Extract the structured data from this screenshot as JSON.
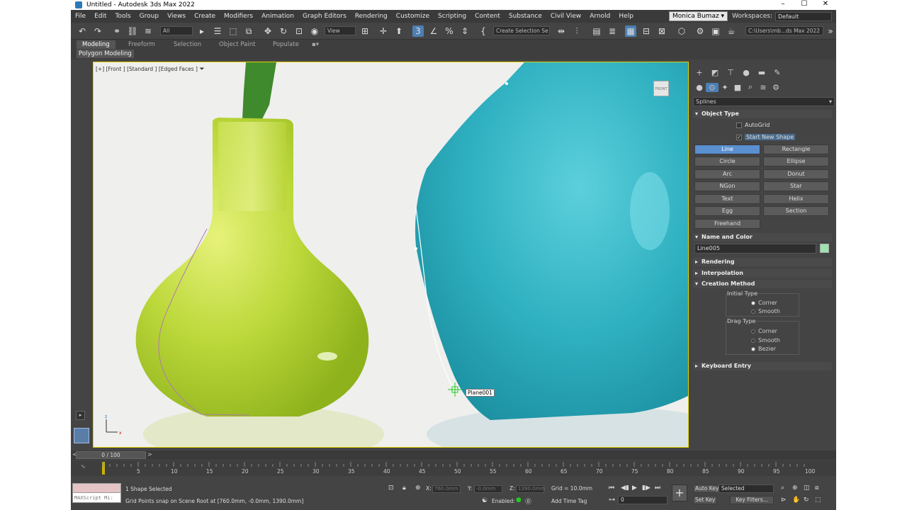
{
  "window": {
    "title": "Untitled - Autodesk 3ds Max 2022"
  },
  "menu": {
    "items": [
      "File",
      "Edit",
      "Tools",
      "Group",
      "Views",
      "Create",
      "Modifiers",
      "Animation",
      "Graph Editors",
      "Rendering",
      "Customize",
      "Scripting",
      "Content",
      "Substance",
      "Civil View",
      "Arnold",
      "Help"
    ],
    "user": "Monica Bumaz",
    "workspaces_label": "Workspaces:",
    "workspace_value": "Default"
  },
  "toolbar": {
    "selection_filter": "All",
    "ref_coord": "View",
    "selection_set": "Create Selection Se",
    "project_path": "C:\\Users\\mb...ds Max 2022"
  },
  "ribbon": {
    "tabs": [
      "Modeling",
      "Freeform",
      "Selection",
      "Object Paint",
      "Populate"
    ],
    "sub_label": "Polygon Modeling"
  },
  "viewport": {
    "label": "[+] [Front ] [Standard ] [Edged Faces ]",
    "viewcube": "FRONT",
    "snap_tooltip": "Plane001"
  },
  "command_panel": {
    "category": "Splines",
    "object_type": {
      "title": "Object Type",
      "autogrid": "AutoGrid",
      "start_new_shape": "Start New Shape",
      "buttons": [
        "Line",
        "Rectangle",
        "Circle",
        "Ellipse",
        "Arc",
        "Donut",
        "NGon",
        "Star",
        "Text",
        "Helix",
        "Egg",
        "Section",
        "Freehand"
      ]
    },
    "name_and_color": {
      "title": "Name and Color",
      "name": "Line005",
      "color": "#9de2b0"
    },
    "rendering_title": "Rendering",
    "interpolation_title": "Interpolation",
    "creation_method": {
      "title": "Creation Method",
      "initial_type": "Initial Type",
      "initial_options": [
        "Corner",
        "Smooth"
      ],
      "drag_type": "Drag Type",
      "drag_options": [
        "Corner",
        "Smooth",
        "Bezier"
      ]
    },
    "keyboard_entry_title": "Keyboard Entry"
  },
  "timeline": {
    "slider": "0 / 100",
    "ticks": [
      "5",
      "10",
      "15",
      "20",
      "25",
      "30",
      "35",
      "40",
      "45",
      "50",
      "55",
      "60",
      "65",
      "70",
      "75",
      "80",
      "85",
      "90",
      "95",
      "100"
    ]
  },
  "status": {
    "maxscript": "MAXScript Mi:",
    "selection": "1 Shape Selected",
    "prompt": "Grid Points snap on Scene Root at [760.0mm, -0.0mm, 1390.0mm]",
    "x_label": "X:",
    "x_value": "760.0mm",
    "y_label": "Y:",
    "y_value": "-0.0mm",
    "z_label": "Z:",
    "z_value": "1390.0mm",
    "grid": "Grid = 10.0mm",
    "enabled": "Enabled:",
    "add_time_tag": "Add Time Tag",
    "auto_key": "Auto Key",
    "set_key": "Set Key",
    "selected": "Selected",
    "key_filters": "Key Filters...",
    "frame": "0"
  }
}
